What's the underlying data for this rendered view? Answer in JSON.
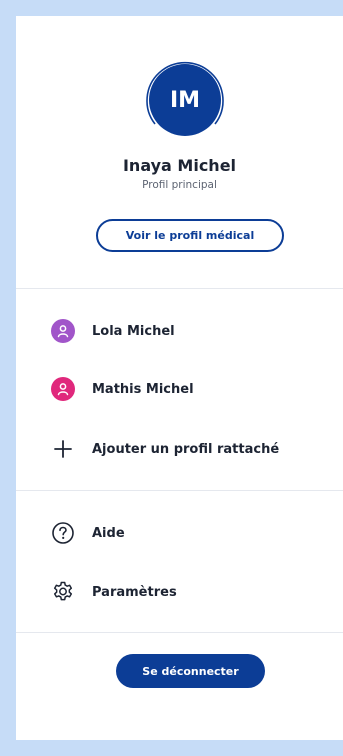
{
  "profile": {
    "initials": "IM",
    "name": "Inaya Michel",
    "subtitle": "Profil principal",
    "view_button": "Voir le profil médical"
  },
  "attached_profiles": [
    {
      "name": "Lola Michel",
      "color": "#a155c9",
      "icon": "user-icon"
    },
    {
      "name": "Mathis Michel",
      "color": "#e0287c",
      "icon": "user-icon"
    }
  ],
  "add_profile": {
    "label": "Ajouter un profil rattaché",
    "icon": "plus-icon"
  },
  "menu": [
    {
      "label": "Aide",
      "icon": "help-icon"
    },
    {
      "label": "Paramètres",
      "icon": "gear-icon"
    }
  ],
  "logout_button": "Se déconnecter",
  "colors": {
    "primary": "#0c3d96",
    "background": "#c6dcf7",
    "text": "#1d2433"
  }
}
